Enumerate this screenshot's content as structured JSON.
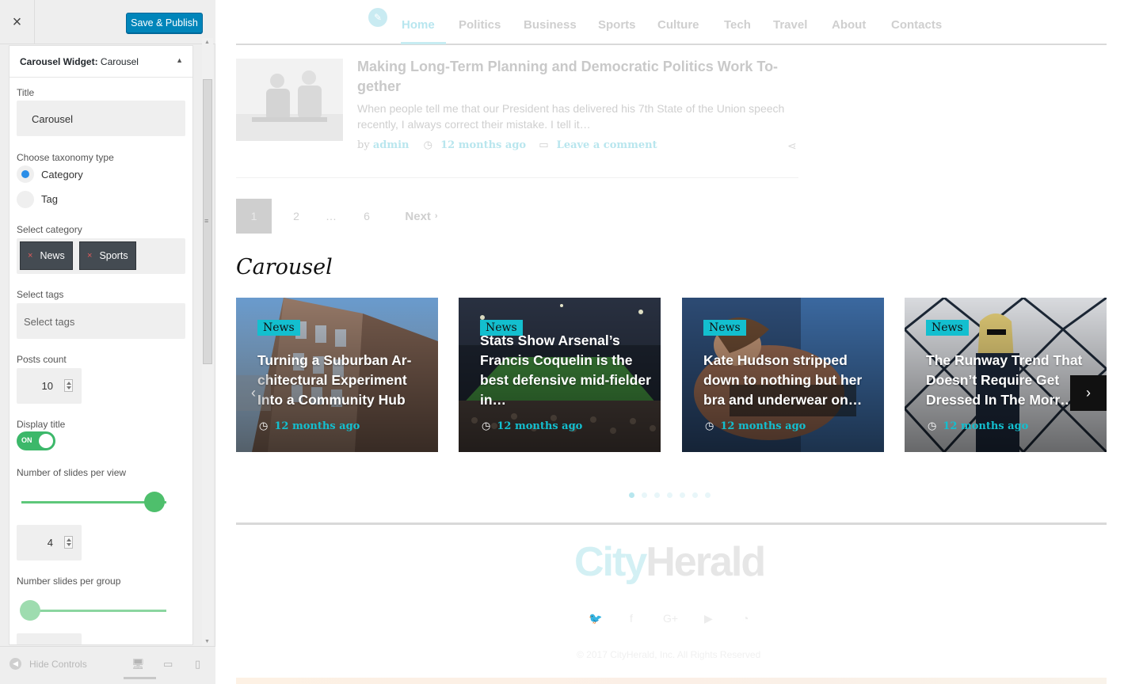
{
  "panel": {
    "close_label": "×",
    "save_label": "Save & Publish",
    "widget_title_prefix": "Carousel Widget:",
    "widget_title_name": " Carousel",
    "widget_toggle": "▲",
    "title_label": "Title",
    "title_value": "Carousel",
    "taxonomy_label": "Choose taxonomy type",
    "taxonomy_options": [
      "Category",
      "Tag"
    ],
    "taxonomy_selected": "Category",
    "category_label": "Select category",
    "categories": [
      "News",
      "Sports"
    ],
    "chip_remove": "×",
    "tags_label": "Select tags",
    "tags_placeholder": "Select tags",
    "posts_count_label": "Posts count",
    "posts_count": "10",
    "display_title_label": "Display title",
    "display_title_state": "ON",
    "slides_per_view_label": "Number of slides per view",
    "slides_per_view": "4",
    "slides_per_group_label": "Number slides per group",
    "hide_controls": "Hide Controls",
    "hide_controls_icon": "◀",
    "device_icons": [
      "🖥",
      "▭",
      "▯"
    ]
  },
  "preview": {
    "nav_items": [
      "Home",
      "Politics",
      "Business",
      "Sports",
      "Culture",
      "Tech",
      "Travel",
      "About",
      "Contacts"
    ],
    "nav_active": "Home",
    "post": {
      "title": "Making Long-Term Planning and Democratic Politics Work To-gether",
      "excerpt": "When people tell me that our President has delivered his 7th State of the Union speech recently, I always correct their mistake.  I tell it…",
      "by": "by",
      "author": "admin",
      "time": "12 months ago",
      "comment": "Leave a comment"
    },
    "pagination": {
      "current": "1",
      "pages": [
        "2",
        "…",
        "6"
      ],
      "next": "Next"
    },
    "carousel_heading": "Carousel",
    "cards": [
      {
        "tag": "News",
        "title": "Turning a Suburban Ar-chitectural Experiment Into a Community Hub",
        "time": "12 months ago"
      },
      {
        "tag": "News",
        "title": "Stats Show Arsenal’s Francis Coquelin is the best defensive mid-fielder in…",
        "time": "12 months ago"
      },
      {
        "tag": "News",
        "title": "Kate Hudson stripped down to nothing but her bra and underwear on…",
        "time": "12 months ago"
      },
      {
        "tag": "News",
        "title": "The Runway Trend That Doesn’t Require Get Dressed In The Morr…",
        "time": "12 months ago"
      }
    ],
    "slider_dots_total": 7,
    "slider_dots_active": 1,
    "logo_part1": "City",
    "logo_part2": "Herald",
    "copyright": "© 2017 CityHerald, Inc. All Rights Reserved",
    "social_icons": [
      "twitter-icon",
      "facebook-icon",
      "google-plus-icon",
      "youtube-icon",
      "rss-icon"
    ]
  },
  "colors": {
    "accent": "#13bfcf",
    "save_button": "#0085ba",
    "toggle_on": "#3cb86a",
    "slider": "#4ebf6c"
  }
}
